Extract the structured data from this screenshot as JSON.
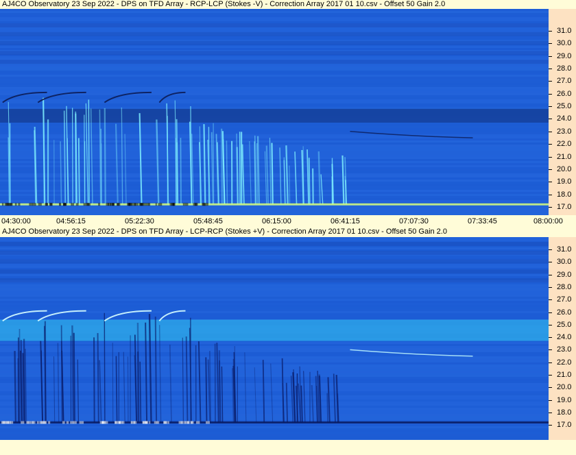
{
  "panels": [
    {
      "title": "AJ4CO Observatory 23 Sep 2022  -  DPS on TFD Array  -  RCP-LCP (Stokes -V)  -  Correction Array 2017 01 10.csv  -  Offset 50  Gain 2.0"
    },
    {
      "title": "AJ4CO Observatory 23 Sep 2022  -  DPS on TFD Array  -  LCP-RCP (Stokes +V)  -  Correction Array 2017 01 10.csv  -  Offset 50  Gain 2.0"
    }
  ],
  "time_axis": [
    "04:30:00",
    "04:56:15",
    "05:22:30",
    "05:48:45",
    "06:15:00",
    "06:41:15",
    "07:07:30",
    "07:33:45",
    "08:00:00"
  ],
  "freq_ticks": [
    "31.0",
    "30.0",
    "29.0",
    "28.0",
    "27.0",
    "26.0",
    "25.0",
    "24.0",
    "23.0",
    "22.0",
    "21.0",
    "20.0",
    "19.0",
    "18.0",
    "17.0"
  ],
  "colors": {
    "background": "#fffcd8",
    "axis_panel": "#fde2c2",
    "spectrogram_base": "#1e5fd8",
    "dark_band": "#143f9a",
    "bright_band": "#33c8f0"
  },
  "chart_data": [
    {
      "type": "heatmap",
      "title": "AJ4CO Observatory 23 Sep 2022  -  DPS on TFD Array  -  RCP-LCP (Stokes -V)  -  Correction Array 2017 01 10.csv  -  Offset 50  Gain 2.0",
      "x": [
        "04:30:00",
        "04:56:15",
        "05:22:30",
        "05:48:45",
        "06:15:00",
        "06:41:15",
        "07:07:30",
        "07:33:45",
        "08:00:00"
      ],
      "xlim": [
        "04:30:00",
        "08:00:00"
      ],
      "ylim": [
        16.5,
        31.8
      ],
      "yticks": [
        31.0,
        30.0,
        29.0,
        28.0,
        27.0,
        26.0,
        25.0,
        24.0,
        23.0,
        22.0,
        21.0,
        20.0,
        19.0,
        18.0,
        17.0
      ],
      "legend": "none",
      "features": [
        {
          "kind": "dark band",
          "freq": [
            23.7,
            24.8
          ],
          "time": [
            "04:30:00",
            "08:00:00"
          ]
        },
        {
          "kind": "bright bursts",
          "freq": [
            17.0,
            26.0
          ],
          "time": [
            "04:33:00",
            "06:43:00"
          ]
        },
        {
          "kind": "bright interference line",
          "freq": 17.2,
          "time": [
            "04:30:00",
            "08:00:00"
          ]
        },
        {
          "kind": "dark sweeping arcs",
          "freq": [
            24.9,
            26.2
          ],
          "time": [
            "04:31:00",
            "05:41:00"
          ]
        },
        {
          "kind": "dark drift line",
          "freq": [
            22.6,
            23.0
          ],
          "time": [
            "06:44:00",
            "07:31:00"
          ]
        }
      ]
    },
    {
      "type": "heatmap",
      "title": "AJ4CO Observatory 23 Sep 2022  -  DPS on TFD Array  -  LCP-RCP (Stokes +V)  -  Correction Array 2017 01 10.csv  -  Offset 50  Gain 2.0",
      "x": [
        "04:30:00",
        "04:56:15",
        "05:22:30",
        "05:48:45",
        "06:15:00",
        "06:41:15",
        "07:07:30",
        "07:33:45",
        "08:00:00"
      ],
      "xlim": [
        "04:30:00",
        "08:00:00"
      ],
      "ylim": [
        16.5,
        31.8
      ],
      "yticks": [
        31.0,
        30.0,
        29.0,
        28.0,
        27.0,
        26.0,
        25.0,
        24.0,
        23.0,
        22.0,
        21.0,
        20.0,
        19.0,
        18.0,
        17.0
      ],
      "legend": "none",
      "features": [
        {
          "kind": "bright band",
          "freq": [
            23.7,
            25.4
          ],
          "time": [
            "04:30:00",
            "08:00:00"
          ]
        },
        {
          "kind": "dark bursts",
          "freq": [
            17.0,
            26.0
          ],
          "time": [
            "04:33:00",
            "06:43:00"
          ]
        },
        {
          "kind": "dark interference line",
          "freq": 17.2,
          "time": [
            "04:30:00",
            "08:00:00"
          ]
        },
        {
          "kind": "bright sweeping arcs",
          "freq": [
            24.9,
            26.2
          ],
          "time": [
            "04:31:00",
            "05:41:00"
          ]
        },
        {
          "kind": "bright drift line",
          "freq": [
            22.6,
            23.0
          ],
          "time": [
            "06:44:00",
            "07:31:00"
          ]
        }
      ]
    }
  ]
}
